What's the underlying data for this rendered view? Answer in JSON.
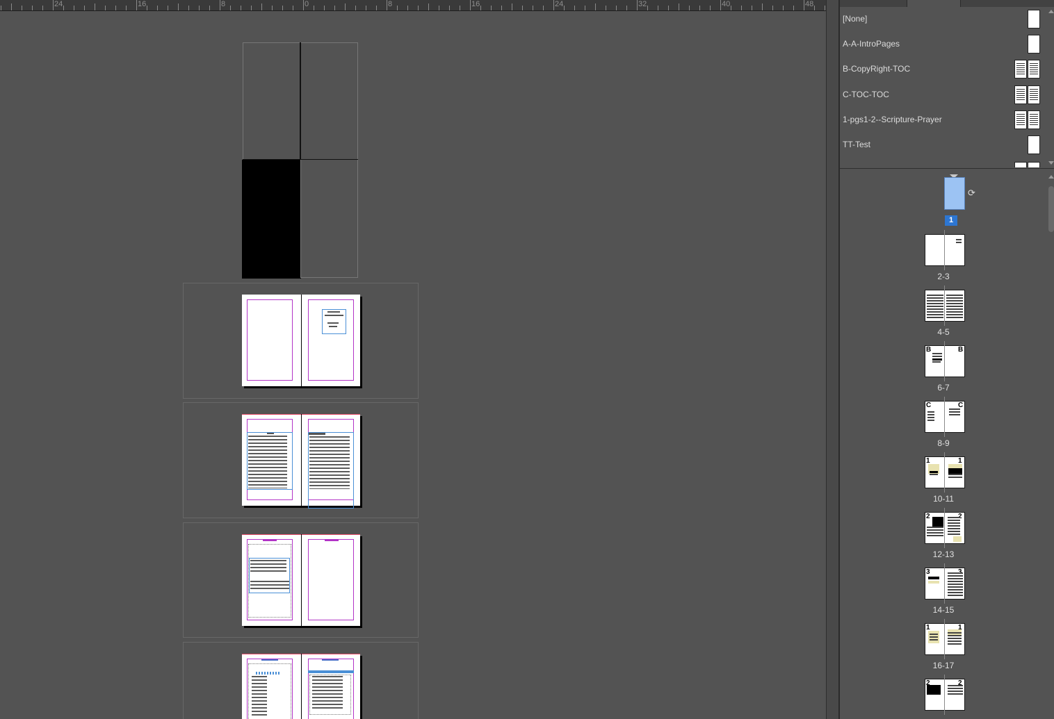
{
  "ruler": {
    "labels": [
      "24",
      "16",
      "8",
      "0",
      "8",
      "16",
      "24",
      "32",
      "40",
      "48"
    ]
  },
  "panel": {
    "masters": [
      {
        "label": "[None]",
        "thumbs": "blank-single"
      },
      {
        "label": "A-A-IntroPages",
        "thumbs": "blank-single"
      },
      {
        "label": "B-CopyRight-TOC",
        "thumbs": "text-spread"
      },
      {
        "label": "C-TOC-TOC",
        "thumbs": "text-spread"
      },
      {
        "label": "1-pgs1-2--Scripture-Prayer",
        "thumbs": "text-spread"
      },
      {
        "label": "TT-Test",
        "thumbs": "blank-single"
      }
    ],
    "pages": [
      {
        "label": "1",
        "selected": true
      },
      {
        "label": "2-3"
      },
      {
        "label": "4-5"
      },
      {
        "label": "6-7",
        "master_left": "B",
        "master_right": "B"
      },
      {
        "label": "8-9",
        "master_left": "C",
        "master_right": "C"
      },
      {
        "label": "10-11",
        "master_left": "1",
        "master_right": "1"
      },
      {
        "label": "12-13",
        "master_left": "2",
        "master_right": "2"
      },
      {
        "label": "14-15",
        "master_left": "3",
        "master_right": "3"
      },
      {
        "label": "16-17",
        "master_left": "1",
        "master_right": "1"
      },
      {
        "label": "",
        "master_left": "2",
        "master_right": "2"
      }
    ],
    "rotate_icon": "rotate-spread-icon"
  },
  "colors": {
    "selection": "#2d76d2",
    "margin": "#b233c7",
    "frame": "#4a8fd6",
    "bleed": "#e94d6a"
  }
}
